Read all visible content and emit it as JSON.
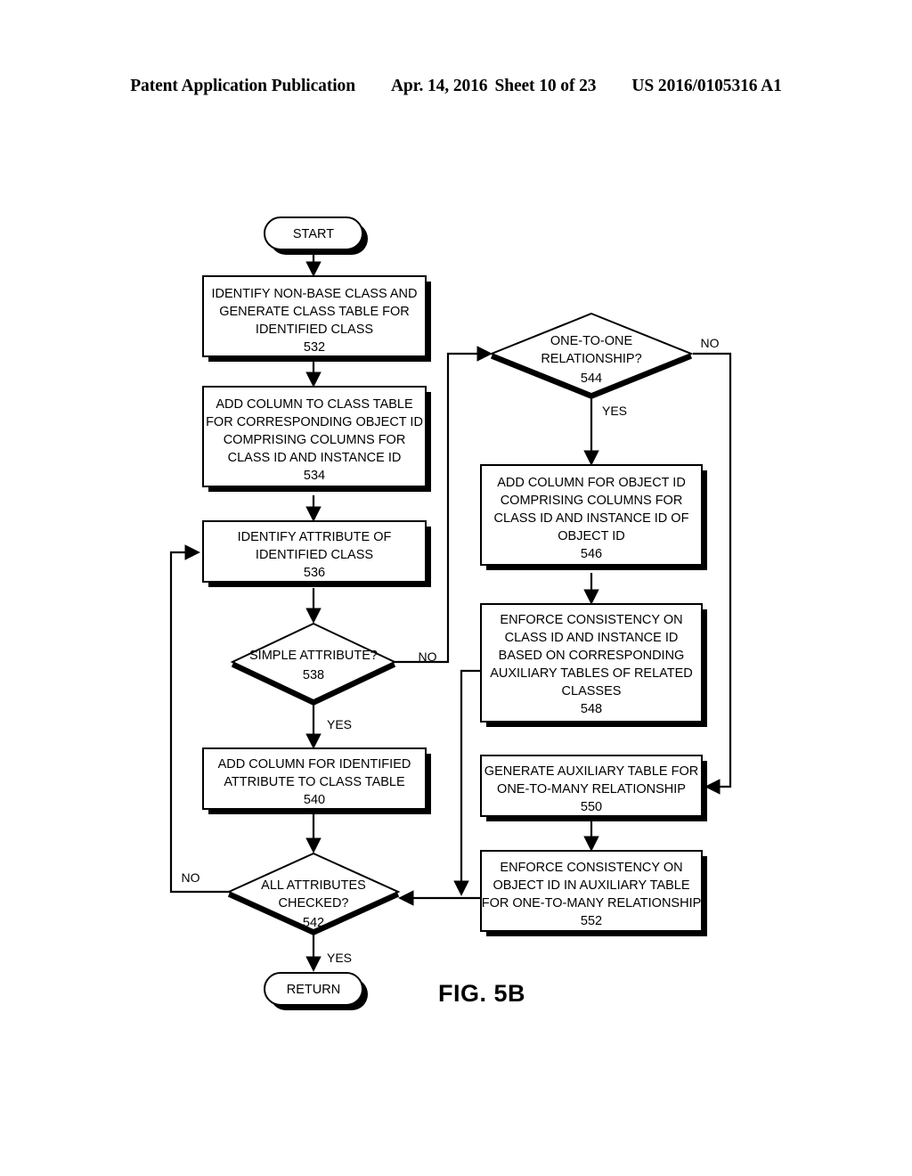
{
  "header": {
    "publication": "Patent Application Publication",
    "date": "Apr. 14, 2016",
    "sheet": "Sheet 10 of 23",
    "number": "US 2016/0105316 A1"
  },
  "figure": {
    "caption": "FIG. 5B"
  },
  "flowchart": {
    "terminals": {
      "start": "START",
      "return": "RETURN"
    },
    "nodes": [
      {
        "id": "532",
        "type": "process",
        "lines": [
          "IDENTIFY NON-BASE CLASS AND",
          "GENERATE CLASS TABLE FOR",
          "IDENTIFIED CLASS"
        ],
        "ref": "532"
      },
      {
        "id": "534",
        "type": "process",
        "lines": [
          "ADD COLUMN TO CLASS TABLE",
          "FOR CORRESPONDING OBJECT ID",
          "COMPRISING COLUMNS FOR",
          "CLASS ID AND INSTANCE ID"
        ],
        "ref": "534"
      },
      {
        "id": "536",
        "type": "process",
        "lines": [
          "IDENTIFY ATTRIBUTE OF",
          "IDENTIFIED CLASS"
        ],
        "ref": "536"
      },
      {
        "id": "538",
        "type": "decision",
        "lines": [
          "SIMPLE ATTRIBUTE?"
        ],
        "ref": "538"
      },
      {
        "id": "540",
        "type": "process",
        "lines": [
          "ADD COLUMN FOR IDENTIFIED",
          "ATTRIBUTE TO CLASS TABLE"
        ],
        "ref": "540"
      },
      {
        "id": "542",
        "type": "decision",
        "lines": [
          "ALL ATTRIBUTES",
          "CHECKED?"
        ],
        "ref": "542"
      },
      {
        "id": "544",
        "type": "decision",
        "lines": [
          "ONE-TO-ONE",
          "RELATIONSHIP?"
        ],
        "ref": "544"
      },
      {
        "id": "546",
        "type": "process",
        "lines": [
          "ADD COLUMN FOR OBJECT ID",
          "COMPRISING COLUMNS FOR",
          "CLASS ID AND INSTANCE ID OF",
          "OBJECT ID"
        ],
        "ref": "546"
      },
      {
        "id": "548",
        "type": "process",
        "lines": [
          "ENFORCE CONSISTENCY ON",
          "CLASS ID AND INSTANCE ID",
          "BASED ON CORRESPONDING",
          "AUXILIARY TABLES OF RELATED",
          "CLASSES"
        ],
        "ref": "548"
      },
      {
        "id": "550",
        "type": "process",
        "lines": [
          "GENERATE AUXILIARY TABLE FOR",
          "ONE-TO-MANY RELATIONSHIP"
        ],
        "ref": "550"
      },
      {
        "id": "552",
        "type": "process",
        "lines": [
          "ENFORCE CONSISTENCY ON",
          "OBJECT ID IN AUXILIARY TABLE",
          "FOR ONE-TO-MANY RELATIONSHIP"
        ],
        "ref": "552"
      }
    ],
    "edge_labels": {
      "n538_no": "NO",
      "n538_yes": "YES",
      "n542_no": "NO",
      "n542_yes": "YES",
      "n544_no": "NO",
      "n544_yes": "YES"
    }
  },
  "colors": {
    "ink": "#000000",
    "paper": "#ffffff"
  }
}
